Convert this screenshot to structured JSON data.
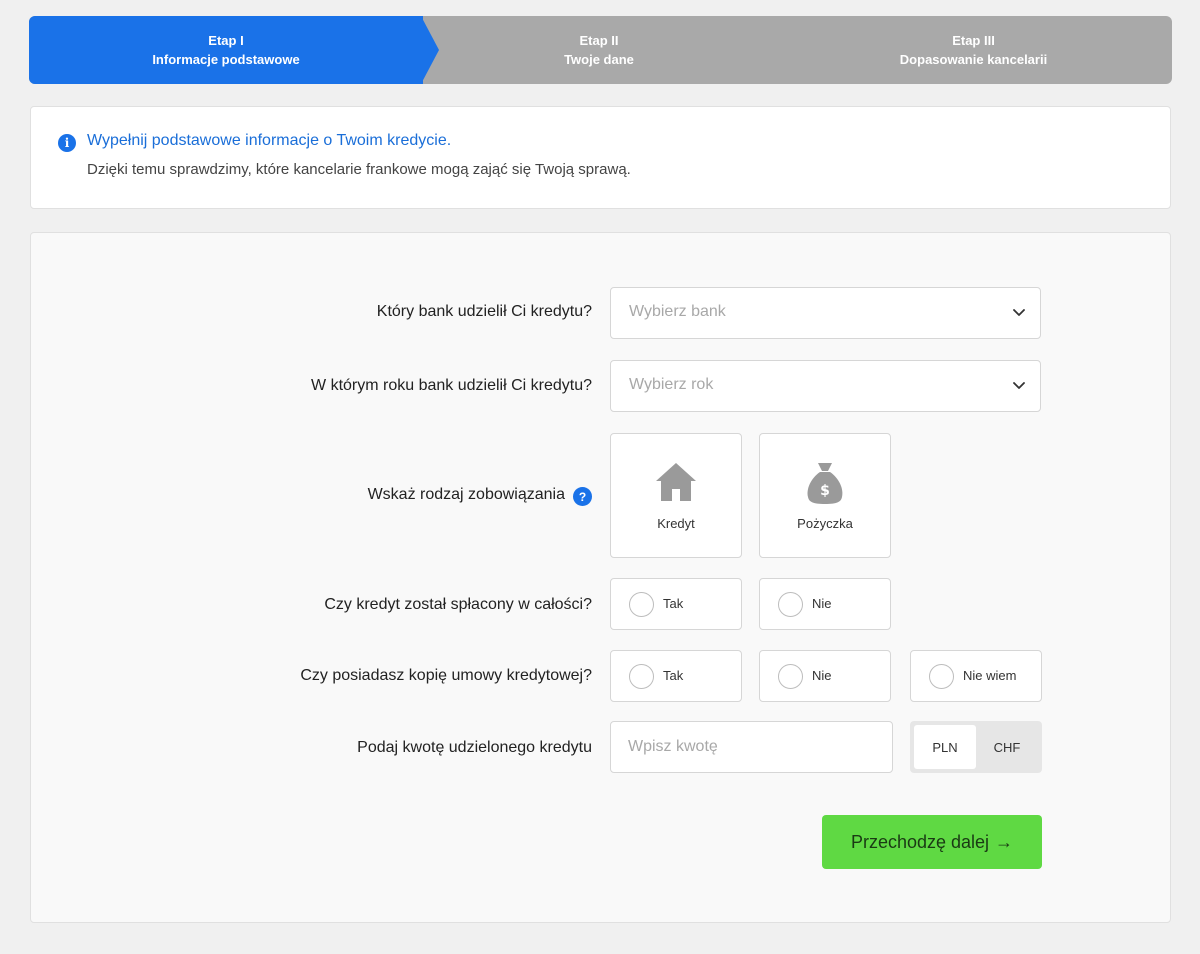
{
  "steps": [
    {
      "label": "Etap I",
      "title": "Informacje podstawowe",
      "active": true
    },
    {
      "label": "Etap II",
      "title": "Twoje dane",
      "active": false
    },
    {
      "label": "Etap III",
      "title": "Dopasowanie kancelarii",
      "active": false
    }
  ],
  "info": {
    "title": "Wypełnij podstawowe informacje o Twoim kredycie.",
    "text": "Dzięki temu sprawdzimy, które kancelarie frankowe mogą zająć się Twoją sprawą.",
    "icon": "info-icon"
  },
  "form": {
    "bank": {
      "label": "Który bank udzielił Ci kredytu?",
      "placeholder": "Wybierz bank"
    },
    "year": {
      "label": "W którym roku bank udzielił Ci kredytu?",
      "placeholder": "Wybierz rok"
    },
    "type": {
      "label": "Wskaż rodzaj zobowiązania",
      "help": "?",
      "options": [
        {
          "label": "Kredyt",
          "icon": "house-icon"
        },
        {
          "label": "Pożyczka",
          "icon": "money-bag-icon",
          "icon_glyph": "$"
        }
      ]
    },
    "repaid": {
      "label": "Czy kredyt został spłacony w całości?",
      "options": [
        "Tak",
        "Nie"
      ]
    },
    "copy": {
      "label": "Czy posiadasz kopię umowy kredytowej?",
      "options": [
        "Tak",
        "Nie",
        "Nie wiem"
      ]
    },
    "amount": {
      "label": "Podaj kwotę udzielonego kredytu",
      "placeholder": "Wpisz kwotę",
      "currencies": [
        "PLN",
        "CHF"
      ],
      "selected_currency": "PLN"
    },
    "next_button": "Przechodzę dalej",
    "next_arrow": "→"
  },
  "colors": {
    "accent": "#1a72e8",
    "step_inactive": "#a9a9a9",
    "button": "#5fd943"
  }
}
